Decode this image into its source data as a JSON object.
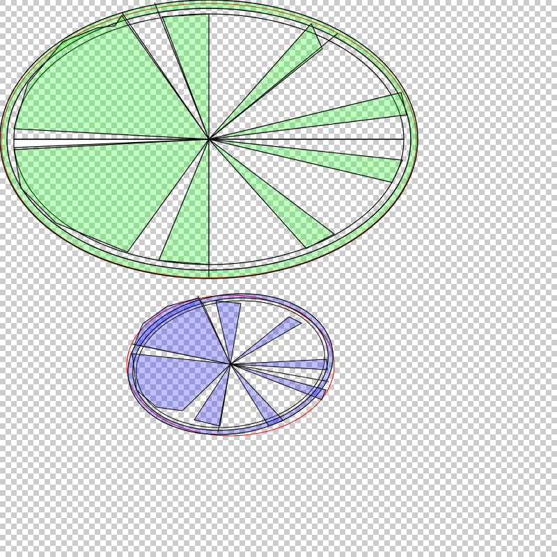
{
  "colors": {
    "checker_light": "#ffffff",
    "checker_dark": "#cccccc",
    "green_fill": "#00ff00",
    "blue_fill": "#0000ff",
    "stroke": "#000000",
    "outline": "#ff0000"
  },
  "diagrams": [
    {
      "id": "green-wheel",
      "fill_color": "#00ff00",
      "fill_opacity": 0.25,
      "segment_count": 10
    },
    {
      "id": "blue-wheel",
      "fill_color": "#0000ff",
      "fill_opacity": 0.25,
      "segment_count": 8
    }
  ]
}
